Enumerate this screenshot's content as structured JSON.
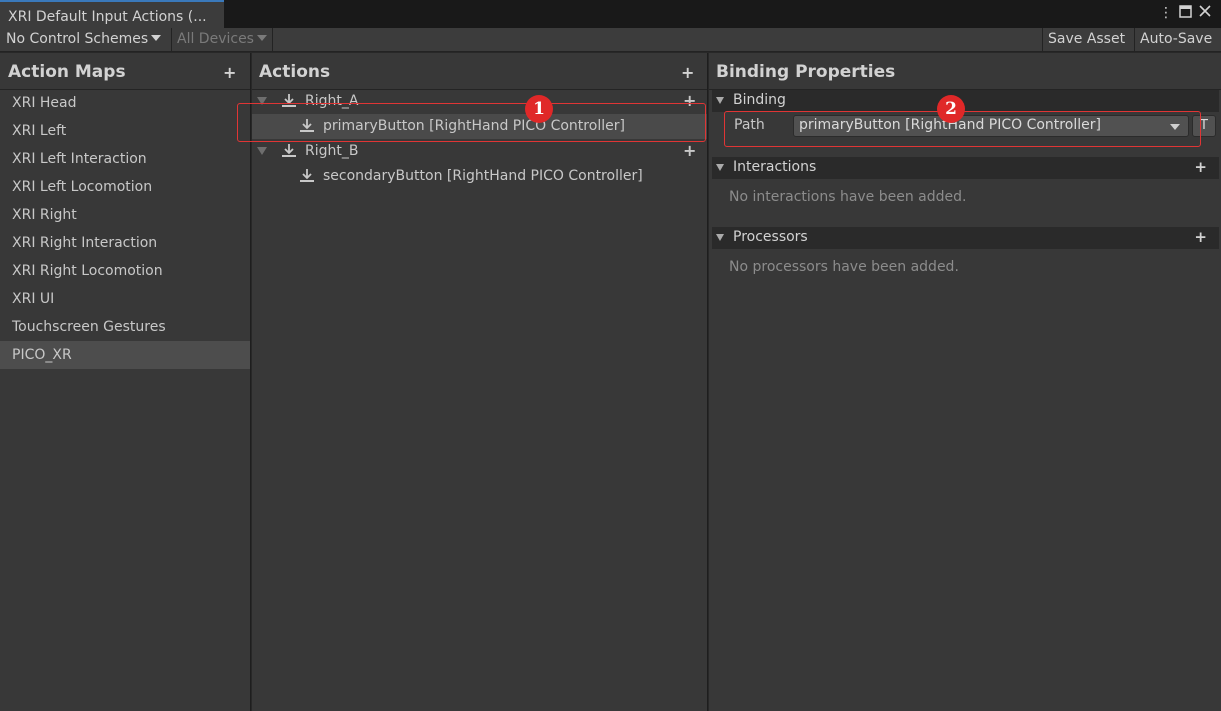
{
  "window": {
    "tab_title": "XRI Default Input Actions (...",
    "controls": {
      "menu_icon": "kebab-menu-icon",
      "maximize_icon": "maximize-icon",
      "close_icon": "close-icon"
    }
  },
  "toolbar": {
    "control_schemes": "No Control Schemes",
    "devices": "All Devices",
    "save_asset": "Save Asset",
    "auto_save": "Auto-Save"
  },
  "action_maps": {
    "title": "Action Maps",
    "items": [
      {
        "label": "XRI Head"
      },
      {
        "label": "XRI Left"
      },
      {
        "label": "XRI Left Interaction"
      },
      {
        "label": "XRI Left Locomotion"
      },
      {
        "label": "XRI Right"
      },
      {
        "label": "XRI Right Interaction"
      },
      {
        "label": "XRI Right Locomotion"
      },
      {
        "label": "XRI UI"
      },
      {
        "label": "Touchscreen Gestures"
      },
      {
        "label": "PICO_XR"
      }
    ],
    "selected": "PICO_XR"
  },
  "actions": {
    "title": "Actions",
    "items": [
      {
        "label": "Right_A",
        "bindings": [
          {
            "label": "primaryButton [RightHand PICO Controller]"
          }
        ]
      },
      {
        "label": "Right_B",
        "bindings": [
          {
            "label": "secondaryButton [RightHand PICO Controller]"
          }
        ]
      }
    ]
  },
  "binding_properties": {
    "title": "Binding Properties",
    "binding_section": "Binding",
    "path_label": "Path",
    "path_value": "primaryButton [RightHand PICO Controller]",
    "t_button": "T",
    "interactions_section": "Interactions",
    "interactions_empty": "No interactions have been added.",
    "processors_section": "Processors",
    "processors_empty": "No processors have been added."
  },
  "annotations": {
    "badge_1": "1",
    "badge_2": "2",
    "color": "#e03535"
  },
  "icons": {
    "plus": "+"
  }
}
